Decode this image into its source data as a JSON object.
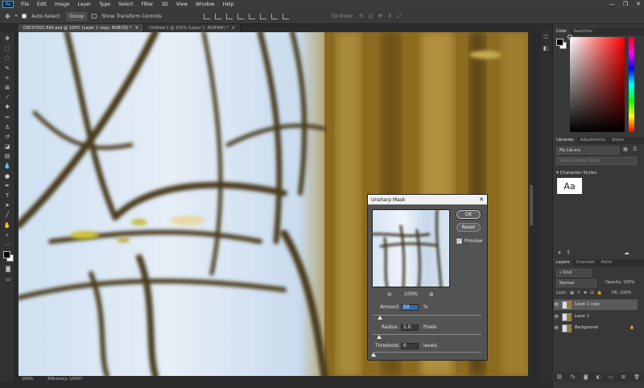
{
  "app": {
    "logo": "Ps"
  },
  "menu": [
    "File",
    "Edit",
    "Image",
    "Layer",
    "Type",
    "Select",
    "Filter",
    "3D",
    "View",
    "Window",
    "Help"
  ],
  "window_controls": {
    "minimize": "—",
    "restore": "❐",
    "close": "✕"
  },
  "options_bar": {
    "auto_select_label": "Auto-Select:",
    "auto_select_value": "Group",
    "transform_label": "Show Transform Controls",
    "mode_label": "3D Mode:"
  },
  "tabs": [
    {
      "label": "DSC07021-Edit.psd @ 100% (Layer 1 copy, RGB/16) *",
      "close": "✕"
    },
    {
      "label": "Untitled-1 @ 100% (Layer 1, RGB/8#) *",
      "close": "✕"
    }
  ],
  "status": {
    "zoom": "100%",
    "info": "Efficiency: 100%*"
  },
  "color_panel": {
    "tabs": [
      "Color",
      "Swatches"
    ]
  },
  "libraries_panel": {
    "tabs": [
      "Libraries",
      "Adjustments",
      "Styles"
    ],
    "library_name": "My Library",
    "search_placeholder": "Search Adobe Stock",
    "section_title": "Character Styles",
    "thumb_text": "Aa"
  },
  "layers_panel": {
    "tabs": [
      "Layers",
      "Channels",
      "Paths"
    ],
    "kind_label": "Kind",
    "blend_mode": "Normal",
    "opacity_label": "Opacity:",
    "opacity_value": "100%",
    "lock_label": "Lock:",
    "fill_label": "Fill:",
    "fill_value": "100%",
    "layers": [
      {
        "name": "Layer 1 copy",
        "selected": true
      },
      {
        "name": "Layer 1",
        "selected": false
      },
      {
        "name": "Background",
        "selected": false
      }
    ]
  },
  "dialog": {
    "title": "Unsharp Mask",
    "ok_label": "OK",
    "reset_label": "Reset",
    "preview_label": "Preview",
    "preview_checked": true,
    "zoom_value": "100%",
    "amount_label": "Amount:",
    "amount_value": "50",
    "amount_unit": "%",
    "radius_label": "Radius:",
    "radius_value": "1.0",
    "radius_unit": "Pixels",
    "threshold_label": "Threshold:",
    "threshold_value": "0",
    "threshold_unit": "levels"
  }
}
